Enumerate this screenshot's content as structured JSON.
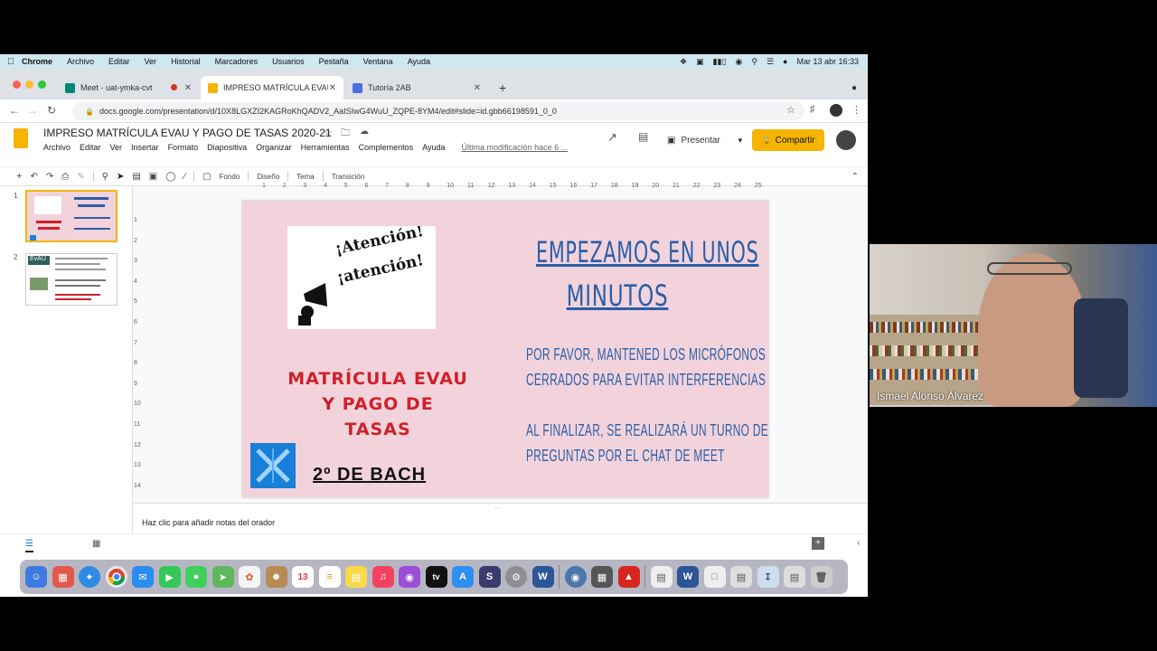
{
  "menubar": {
    "items": [
      "Chrome",
      "Archivo",
      "Editar",
      "Ver",
      "Historial",
      "Marcadores",
      "Usuarios",
      "Pestaña",
      "Ventana",
      "Ayuda"
    ],
    "clock": "Mar 13 abr  16:33"
  },
  "tabs": [
    {
      "title": "Meet - uat-ymka-cvt",
      "active": false
    },
    {
      "title": "IMPRESO MATRÍCULA EVAU Y",
      "active": true
    },
    {
      "title": "Tutoría 2AB",
      "active": false
    }
  ],
  "address": {
    "url": "docs.google.com/presentation/d/10X8LGXZI2KAGRoKhQADV2_AaISIwG4WuU_ZQPE-8YM4/edit#slide=id.gbb66198591_0_0"
  },
  "doc": {
    "title": "IMPRESO MATRÍCULA EVAU Y PAGO DE TASAS 2020-21",
    "menu": [
      "Archivo",
      "Editar",
      "Ver",
      "Insertar",
      "Formato",
      "Diapositiva",
      "Organizar",
      "Herramientas",
      "Complementos",
      "Ayuda"
    ],
    "last_modified": "Última modificación hace 6 ...",
    "present_label": "Presentar",
    "share_label": "Compartir"
  },
  "toolbar": {
    "fondo": "Fondo",
    "diseno": "Diseño",
    "tema": "Tema",
    "transicion": "Transición"
  },
  "filmstrip": {
    "numbers": [
      "1",
      "2"
    ],
    "thumb2_label": "EvAU"
  },
  "slide": {
    "attention_text_1": "¡Atención!",
    "attention_text_2": "¡atención!",
    "title_line1": "EMPEZAMOS EN UNOS",
    "title_line2": "MINUTOS",
    "msg1_line1": "POR FAVOR, MANTENED LOS MICRÓFONOS",
    "msg1_line2": "CERRADOS PARA EVITAR INTERFERENCIAS",
    "msg2_line1": "AL FINALIZAR, SE REALIZARÁ UN TURNO DE",
    "msg2_line2": "PREGUNTAS POR EL CHAT DE MEET",
    "red_line1": "MATRÍCULA EVAU",
    "red_line2": "Y PAGO DE",
    "red_line3": "TASAS",
    "bach": "2º DE BACH"
  },
  "ruler": {
    "h": [
      "1",
      "2",
      "3",
      "4",
      "5",
      "6",
      "7",
      "8",
      "9",
      "10",
      "11",
      "12",
      "13",
      "14",
      "15",
      "16",
      "17",
      "18",
      "19",
      "20",
      "21",
      "22",
      "23",
      "24",
      "25"
    ],
    "v": [
      "1",
      "2",
      "3",
      "4",
      "5",
      "6",
      "7",
      "8",
      "9",
      "10",
      "11",
      "12",
      "13",
      "14"
    ]
  },
  "notes": {
    "placeholder": "Haz clic para añadir notas del orador"
  },
  "dock": {
    "calendar_day": "13",
    "tv_label": "tv"
  },
  "video": {
    "participant": "Ismael Alonso Álvarez"
  },
  "colors": {
    "slide_bg": "#f2d3dc",
    "slide_blue": "#2a5ea8",
    "slide_red": "#d0202a",
    "share_yellow": "#f4b400"
  }
}
